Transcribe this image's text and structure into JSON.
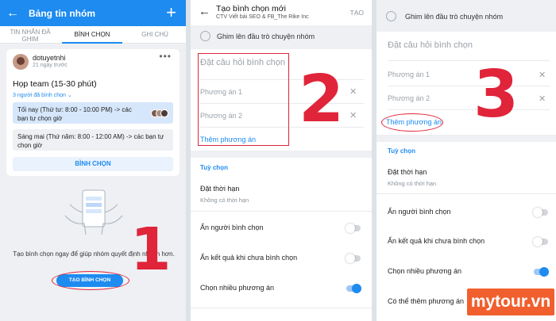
{
  "panel1": {
    "header": {
      "title": "Bảng tin nhóm",
      "back_icon": "←",
      "add_icon": "+"
    },
    "tabs": [
      {
        "label": "TIN NHẮN ĐÃ GHIM"
      },
      {
        "label": "BÌNH CHỌN"
      },
      {
        "label": "GHI CHÚ"
      }
    ],
    "post": {
      "author": "dotuyetnhi",
      "date": "21 ngày trước",
      "title": "Họp team (15-30 phút)",
      "voted": "3 người đã bình chọn ⌄",
      "options": [
        "Tối nay (Thứ tư: 8:00 - 10:00 PM) -> các bạn tự chọn giờ",
        "Sáng mai (Thứ năm: 8:00 - 12:00 AM) -> các bạn tự chọn giờ"
      ],
      "vote_button": "BÌNH CHỌN",
      "more_icon": "•••"
    },
    "empty_message": "Tạo bình chọn ngay để giúp nhóm quyết định nhanh hơn.",
    "create_button": "TẠO BÌNH CHỌN",
    "step": "1"
  },
  "panel2": {
    "title": "Tạo bình chọn mới",
    "subtitle": "CTV Viết bài SEO & FB_The Rike Inc",
    "done": "TẠO",
    "back_icon": "←",
    "pin_label": "Ghim lên đầu trò chuyện nhóm",
    "question_placeholder": "Đặt câu hỏi bình chọn",
    "options": [
      "Phương án 1",
      "Phương án 2"
    ],
    "remove_icon": "✕",
    "add_option": "Thêm phương án",
    "section": "Tuỳ chọn",
    "deadline": "Đặt thời hạn",
    "deadline_value": "Không có thời hạn",
    "settings": [
      {
        "label": "Ẩn người bình chọn",
        "on": false
      },
      {
        "label": "Ẩn kết quả khi chưa bình chọn",
        "on": false
      },
      {
        "label": "Chọn nhiều phương án",
        "on": true
      }
    ],
    "step": "2"
  },
  "panel3": {
    "pin_label": "Ghim lên đầu trò chuyện nhóm",
    "question_placeholder": "Đặt câu hỏi bình chọn",
    "options": [
      "Phương án 1",
      "Phương án 2"
    ],
    "remove_icon": "✕",
    "add_option": "Thêm phương án",
    "section": "Tuỳ chọn",
    "deadline": "Đặt thời hạn",
    "deadline_value": "Không có thời hạn",
    "settings": [
      {
        "label": "Ẩn người bình chọn",
        "on": false
      },
      {
        "label": "Ẩn kết quả khi chưa bình chọn",
        "on": false
      },
      {
        "label": "Chọn nhiều phương án",
        "on": true
      },
      {
        "label": "Có thể thêm phương án",
        "on": false
      }
    ],
    "step": "3"
  },
  "watermark": "mytour.vn",
  "colors": {
    "accent": "#1d8bf0",
    "annotation": "#e0243a",
    "brand": "#f05f2d"
  }
}
